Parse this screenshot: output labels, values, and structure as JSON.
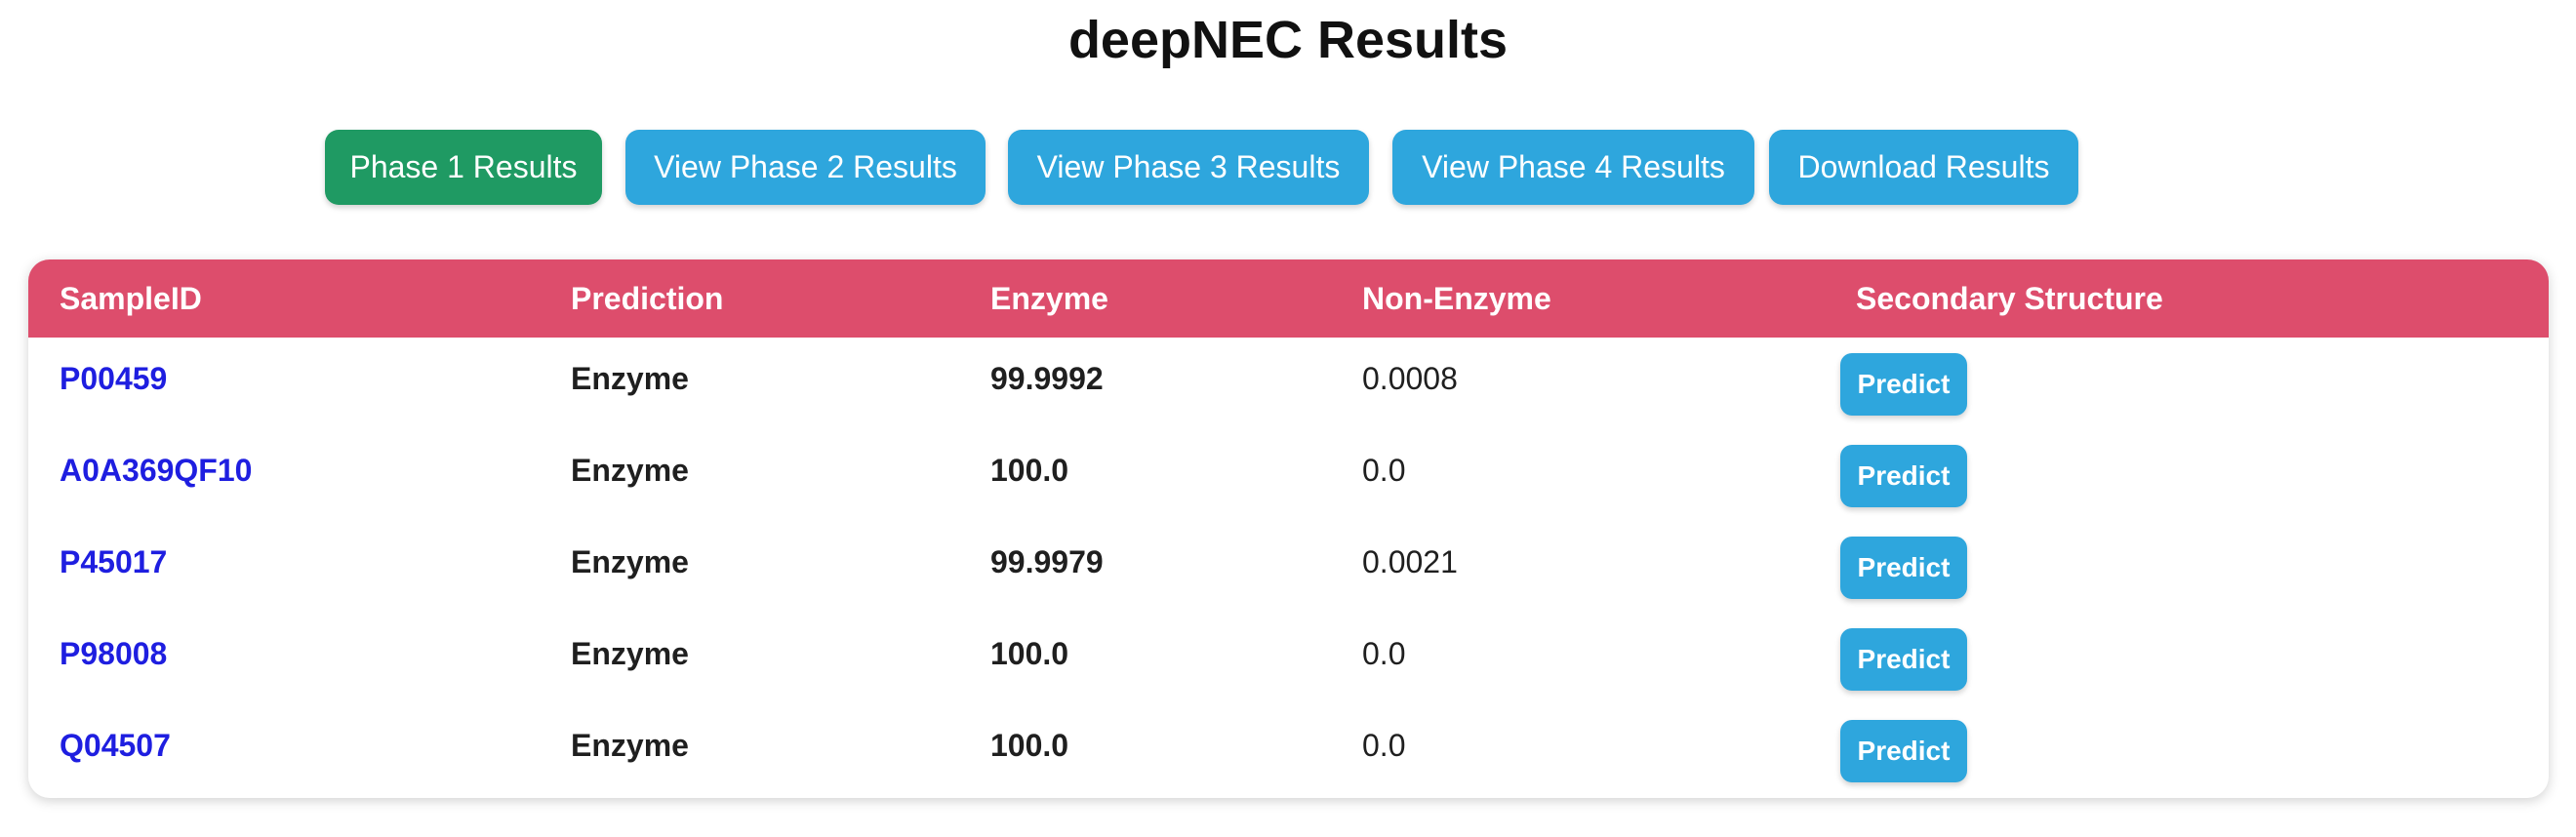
{
  "page": {
    "title": "deepNEC Results"
  },
  "toolbar": {
    "buttons": [
      {
        "label": "Phase 1 Results",
        "color": "#1f9a63"
      },
      {
        "label": "View Phase 2 Results",
        "color": "#2ea6dd"
      },
      {
        "label": "View Phase 3 Results",
        "color": "#2ea6dd"
      },
      {
        "label": "View Phase 4 Results",
        "color": "#2ea6dd"
      },
      {
        "label": "Download Results",
        "color": "#2ea6dd"
      }
    ]
  },
  "table": {
    "header_color": "#dd4d6c",
    "columns": [
      "SampleID",
      "Prediction",
      "Enzyme",
      "Non-Enzyme",
      "Secondary Structure"
    ],
    "rows": [
      {
        "sample_id": "P00459",
        "prediction": "Enzyme",
        "enzyme": "99.9992",
        "non_enzyme": "0.0008",
        "action": "Predict"
      },
      {
        "sample_id": "A0A369QF10",
        "prediction": "Enzyme",
        "enzyme": "100.0",
        "non_enzyme": "0.0",
        "action": "Predict"
      },
      {
        "sample_id": "P45017",
        "prediction": "Enzyme",
        "enzyme": "99.9979",
        "non_enzyme": "0.0021",
        "action": "Predict"
      },
      {
        "sample_id": "P98008",
        "prediction": "Enzyme",
        "enzyme": "100.0",
        "non_enzyme": "0.0",
        "action": "Predict"
      },
      {
        "sample_id": "Q04507",
        "prediction": "Enzyme",
        "enzyme": "100.0",
        "non_enzyme": "0.0",
        "action": "Predict"
      }
    ]
  }
}
